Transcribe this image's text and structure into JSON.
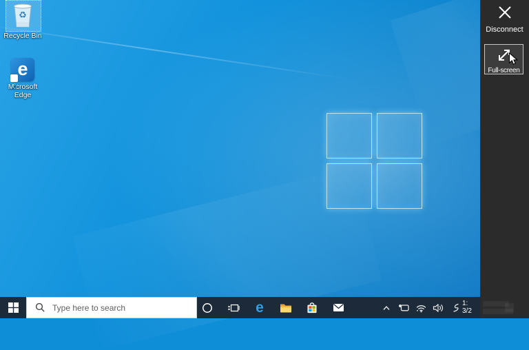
{
  "desktop": {
    "icons": [
      {
        "label": "Recycle Bin",
        "icon": "recycle-bin-icon",
        "selected": true
      },
      {
        "label": "Microsoft Edge",
        "icon": "edge-shortcut-icon",
        "selected": false
      }
    ]
  },
  "taskbar": {
    "search": {
      "placeholder": "Type here to search",
      "icon": "magnifier-icon"
    },
    "app_buttons": [
      "cortana",
      "task-view",
      "edge",
      "file-explorer",
      "store",
      "mail"
    ],
    "tray_icons": [
      "hidden-icons-chevron",
      "pen-tablet",
      "wifi",
      "volume",
      "windows-ink"
    ],
    "edge_glyph": "e",
    "clock": {
      "time": "1:",
      "date": "3/2"
    }
  },
  "remote_toolbar": {
    "disconnect_label": "Disconnect",
    "fullscreen_label": "Full-screen"
  },
  "colors": {
    "wallpaper_base": "#0f8ed8",
    "wallpaper_light": "#2aa3e6",
    "wallpaper_deep": "#0b74c0",
    "taskbar": "#1c2a39",
    "panel": "#2b2b2b",
    "panel_button": "#3d3d3d",
    "panel_border": "#c8c8c8",
    "search_placeholder_text": "#5f5f5f",
    "edge_blue": "#2da0e8",
    "folder_back": "#e8a33d",
    "folder_front": "#fbd86c",
    "store_red": "#f25022",
    "store_green": "#7fba00",
    "store_blue": "#00a4ef",
    "store_yellow": "#ffb900"
  }
}
